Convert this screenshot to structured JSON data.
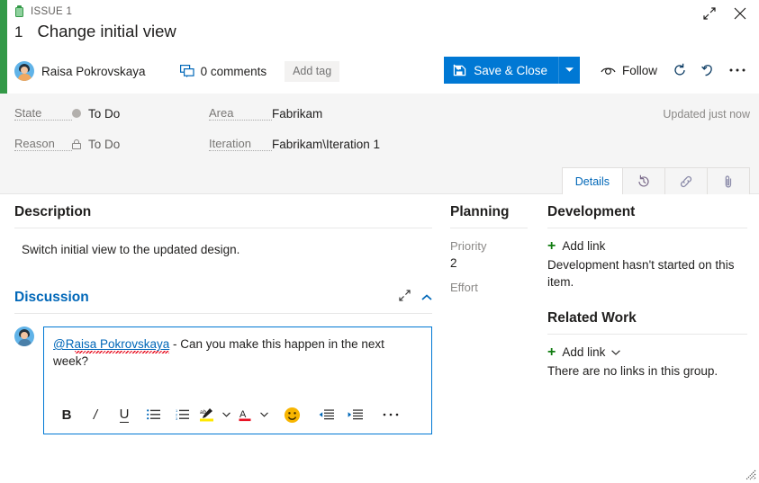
{
  "window": {
    "expand_label": "Expand",
    "close_label": "Close",
    "resize_label": "Resize"
  },
  "header": {
    "breadcrumb": "ISSUE 1",
    "work_item_id": "1",
    "title": "Change initial view",
    "assignee": "Raisa Pokrovskaya",
    "comments": "0 comments",
    "add_tag": "Add tag",
    "save_label": "Save & Close",
    "follow_label": "Follow",
    "refresh_label": "Refresh",
    "revert_label": "Revert",
    "more_label": "More actions",
    "accent_color": "#0078d4",
    "type_color": "#339947"
  },
  "fields": {
    "state_label": "State",
    "state_value": "To Do",
    "reason_label": "Reason",
    "reason_value": "To Do",
    "area_label": "Area",
    "area_value": "Fabrikam",
    "iteration_label": "Iteration",
    "iteration_value": "Fabrikam\\Iteration 1",
    "updated": "Updated just now"
  },
  "tabs": [
    {
      "label": "Details",
      "icon": "details-text",
      "active": true
    },
    {
      "label": "",
      "icon": "history-icon",
      "active": false
    },
    {
      "label": "",
      "icon": "link-icon",
      "active": false
    },
    {
      "label": "",
      "icon": "attachment-icon",
      "active": false
    }
  ],
  "description": {
    "heading": "Description",
    "text": "Switch initial view to the updated design."
  },
  "discussion": {
    "heading": "Discussion",
    "comment_mention": "@Raisa Pokrovskaya",
    "comment_text": " - Can you make this happen in the next week?",
    "toolbar": [
      {
        "name": "bold-icon",
        "glyph": "B"
      },
      {
        "name": "italic-icon",
        "glyph": "I"
      },
      {
        "name": "underline-icon",
        "glyph": "U"
      },
      {
        "name": "bulleted-list-icon",
        "glyph": "•"
      },
      {
        "name": "numbered-list-icon",
        "glyph": "1."
      },
      {
        "name": "highlight-color-icon",
        "glyph": "ab"
      },
      {
        "name": "font-color-icon",
        "glyph": "A"
      },
      {
        "name": "emoji-icon",
        "glyph": "🙂"
      },
      {
        "name": "decrease-indent-icon",
        "glyph": "←"
      },
      {
        "name": "increase-indent-icon",
        "glyph": "→"
      },
      {
        "name": "more-formatting-icon",
        "glyph": "…"
      }
    ]
  },
  "planning": {
    "heading": "Planning",
    "priority_label": "Priority",
    "priority_value": "2",
    "effort_label": "Effort",
    "effort_value": ""
  },
  "development": {
    "heading": "Development",
    "add_link": "Add link",
    "empty_text": "Development hasn't started on this item."
  },
  "related_work": {
    "heading": "Related Work",
    "add_link": "Add link",
    "empty_text": "There are no links in this group."
  }
}
